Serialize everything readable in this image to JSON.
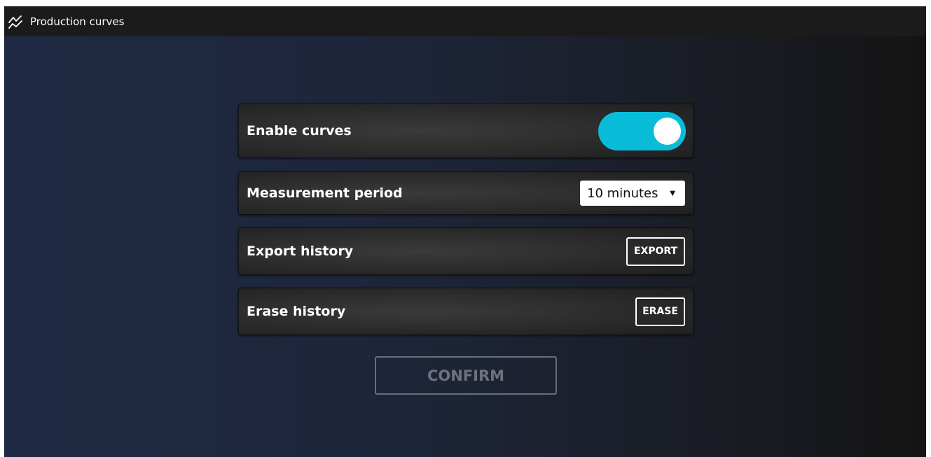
{
  "window": {
    "title": "Production curves",
    "icon": "line-chart-icon"
  },
  "settings": {
    "enable_curves": {
      "label": "Enable curves",
      "state": "on",
      "accent_color": "#08bcd9"
    },
    "measurement_period": {
      "label": "Measurement period",
      "value": "10 minutes",
      "caret": "▼"
    },
    "export_history": {
      "label": "Export history",
      "button_label": "EXPORT"
    },
    "erase_history": {
      "label": "Erase history",
      "button_label": "ERASE"
    }
  },
  "footer": {
    "confirm_label": "CONFIRM",
    "confirm_state": "disabled"
  }
}
